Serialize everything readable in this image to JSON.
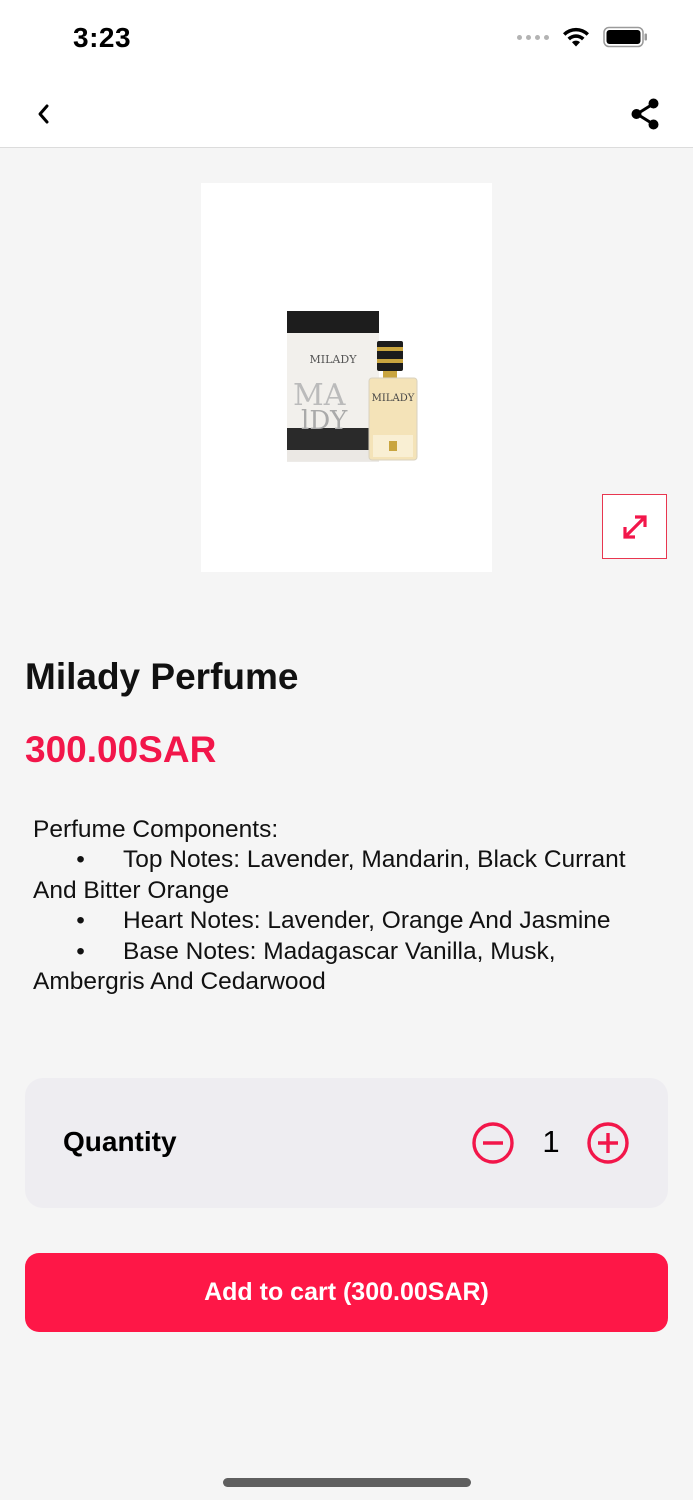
{
  "status_bar": {
    "time": "3:23",
    "icons": [
      "signal-dots-icon",
      "wifi-icon",
      "battery-icon"
    ]
  },
  "nav": {
    "back_icon": "chevron-left-icon",
    "share_icon": "share-icon"
  },
  "product": {
    "image_label": "Milady perfume bottle and box",
    "image_brand_text": "MILADY",
    "expand_icon": "expand-icon",
    "title": "Milady Perfume",
    "price": "300.00SAR"
  },
  "description": {
    "heading": "Perfume Components:",
    "bullets": [
      {
        "first": "Top Notes: Lavender, Mandarin, Black Currant",
        "rest": "And Bitter Orange"
      },
      {
        "first": "Heart Notes: Lavender, Orange And Jasmine",
        "rest": ""
      },
      {
        "first": "Base Notes: Madagascar Vanilla, Musk,",
        "rest": "Ambergris And Cedarwood"
      }
    ]
  },
  "quantity": {
    "label": "Quantity",
    "value": "1",
    "minus_icon": "minus-circle-icon",
    "plus_icon": "plus-circle-icon"
  },
  "cart": {
    "button_label": "Add to cart (300.00SAR)"
  },
  "colors": {
    "accent": "#fe1747",
    "price": "#f2164a",
    "card_bg": "#eeedf1",
    "page_bg": "#f5f5f5"
  }
}
